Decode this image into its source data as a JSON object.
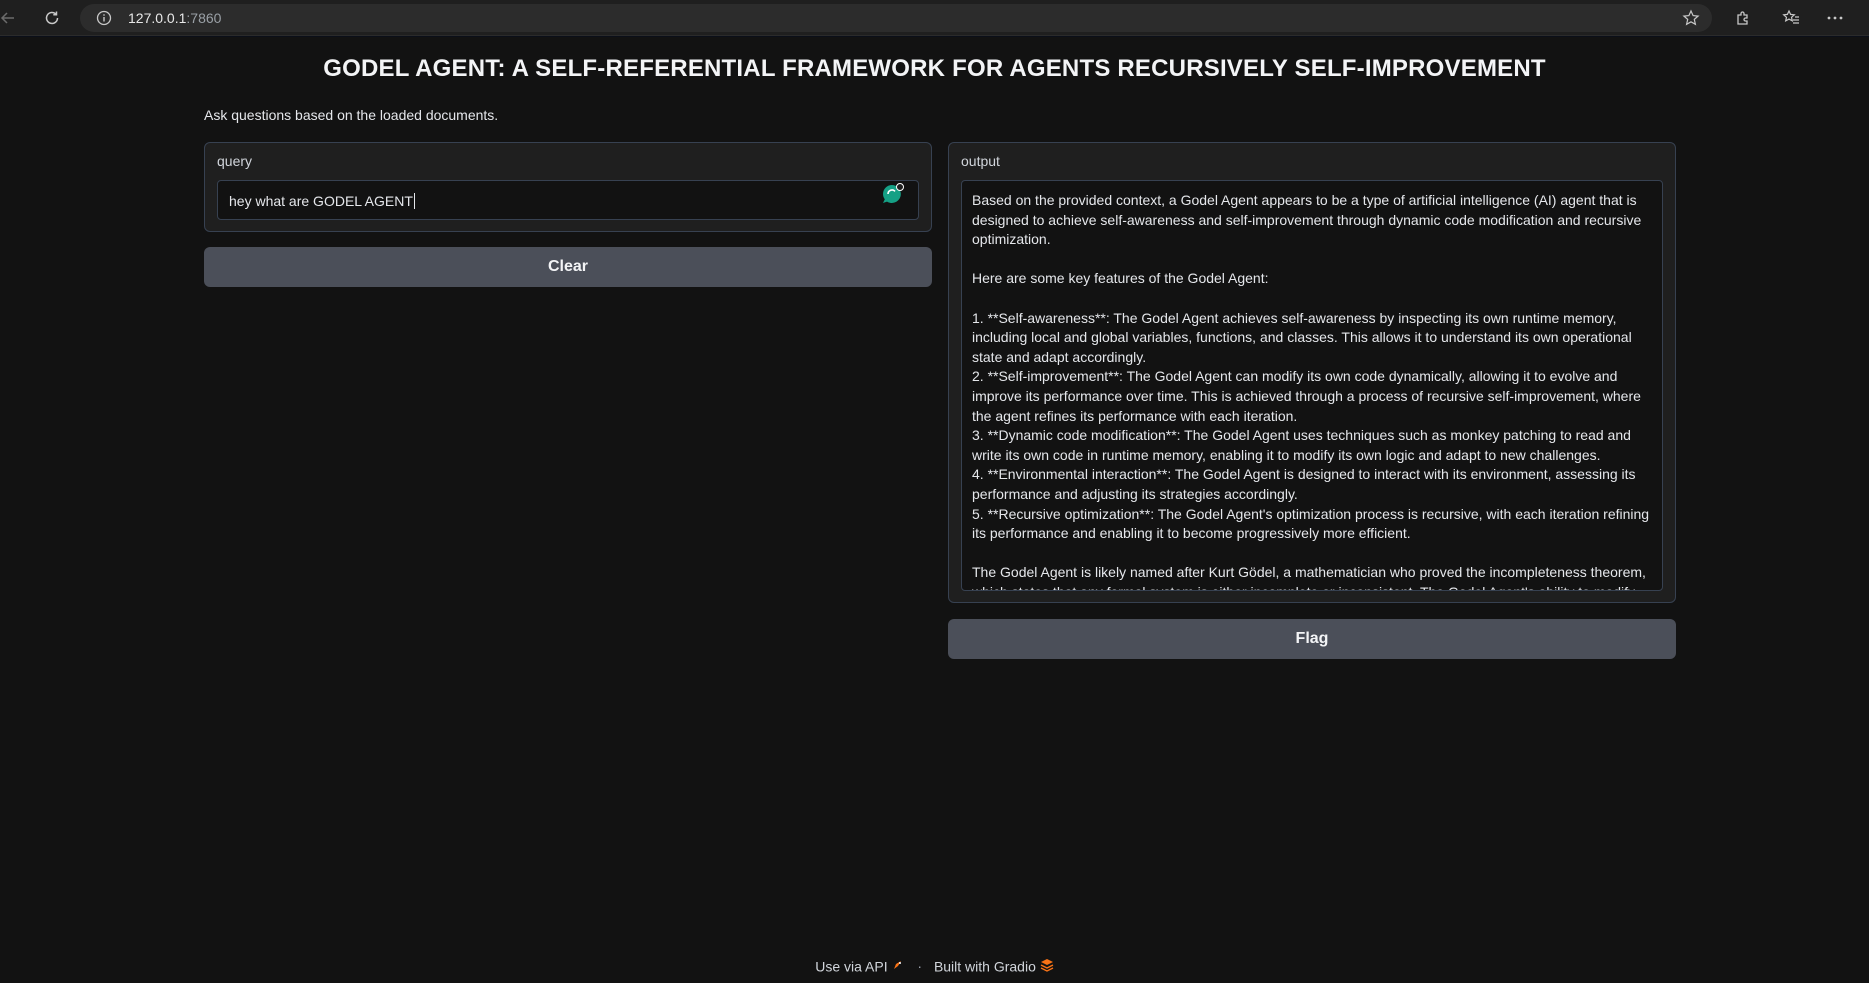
{
  "browser": {
    "url_host": "127.0.0.1",
    "url_port": ":7860"
  },
  "app": {
    "title": "GODEL AGENT: A SELF-REFERENTIAL FRAMEWORK FOR AGENTS RECURSIVELY SELF-IMPROVEMENT",
    "description": "Ask questions based on the loaded documents."
  },
  "query": {
    "label": "query",
    "value": "hey what are GODEL AGENT"
  },
  "output": {
    "label": "output",
    "text": "Based on the provided context, a Godel Agent appears to be a type of artificial intelligence (AI) agent that is designed to achieve self-awareness and self-improvement through dynamic code modification and recursive optimization.\n\nHere are some key features of the Godel Agent:\n\n1. **Self-awareness**: The Godel Agent achieves self-awareness by inspecting its own runtime memory, including local and global variables, functions, and classes. This allows it to understand its own operational state and adapt accordingly.\n2. **Self-improvement**: The Godel Agent can modify its own code dynamically, allowing it to evolve and improve its performance over time. This is achieved through a process of recursive self-improvement, where the agent refines its performance with each iteration.\n3. **Dynamic code modification**: The Godel Agent uses techniques such as monkey patching to read and write its own code in runtime memory, enabling it to modify its own logic and adapt to new challenges.\n4. **Environmental interaction**: The Godel Agent is designed to interact with its environment, assessing its performance and adjusting its strategies accordingly.\n5. **Recursive optimization**: The Godel Agent's optimization process is recursive, with each iteration refining its performance and enabling it to become progressively more efficient.\n\nThe Godel Agent is likely named after Kurt Gödel, a mathematician who proved the incompleteness theorem, which states that any formal system is either incomplete or inconsistent. The Godel Agent's ability to modify its own code and recursively optimize its performance may be seen as a reflection of Gödel's ideas on the limitations of formal systems."
  },
  "buttons": {
    "clear": "Clear",
    "flag": "Flag"
  },
  "footer": {
    "api": "Use via API",
    "separator": "·",
    "built": "Built with Gradio"
  },
  "colors": {
    "background": "#121212",
    "panel": "#1f1f1f",
    "button": "#4b4f59",
    "gradio_logo": "#f97316"
  }
}
